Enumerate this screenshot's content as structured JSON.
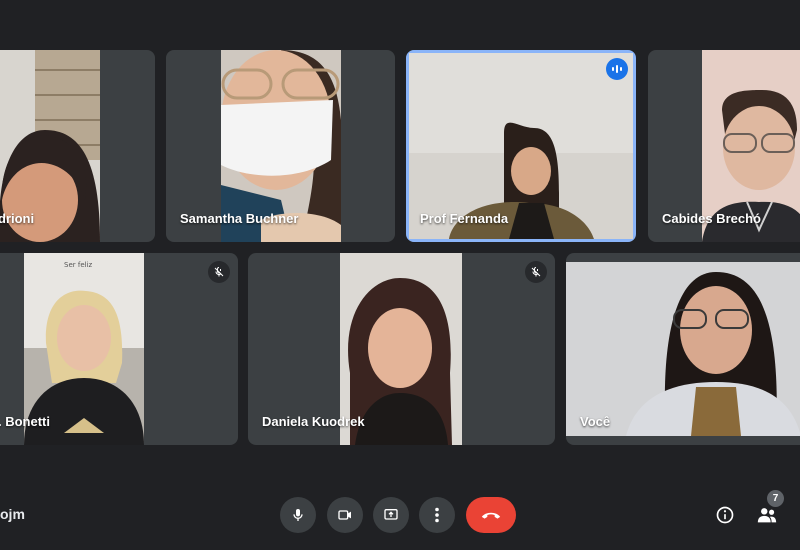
{
  "meeting": {
    "code_fragment": "ojm"
  },
  "participants": [
    {
      "name": "drioni",
      "muted": false,
      "speaking": false
    },
    {
      "name": "Samantha Buchner",
      "muted": false,
      "speaking": false
    },
    {
      "name": "Prof Fernanda",
      "muted": false,
      "speaking": true
    },
    {
      "name": "Cabides Brechó",
      "muted": false,
      "speaking": false
    },
    {
      "name": ". Bonetti",
      "muted": true,
      "speaking": false
    },
    {
      "name": "Daniela Kuodrek",
      "muted": true,
      "speaking": false
    },
    {
      "name": "Você",
      "muted": false,
      "speaking": false
    }
  ],
  "controls": {
    "people_count": "7"
  },
  "colors": {
    "background": "#202124",
    "tile": "#3c4043",
    "active_speaker_border": "#8ab4f8",
    "hang_up": "#ea4335",
    "speaking_indicator": "#1a73e8"
  },
  "icons": [
    "mic-icon",
    "camera-icon",
    "present-icon",
    "more-vert-icon",
    "call-end-icon",
    "info-icon",
    "people-icon",
    "mic-off-icon",
    "audio-level-icon"
  ]
}
